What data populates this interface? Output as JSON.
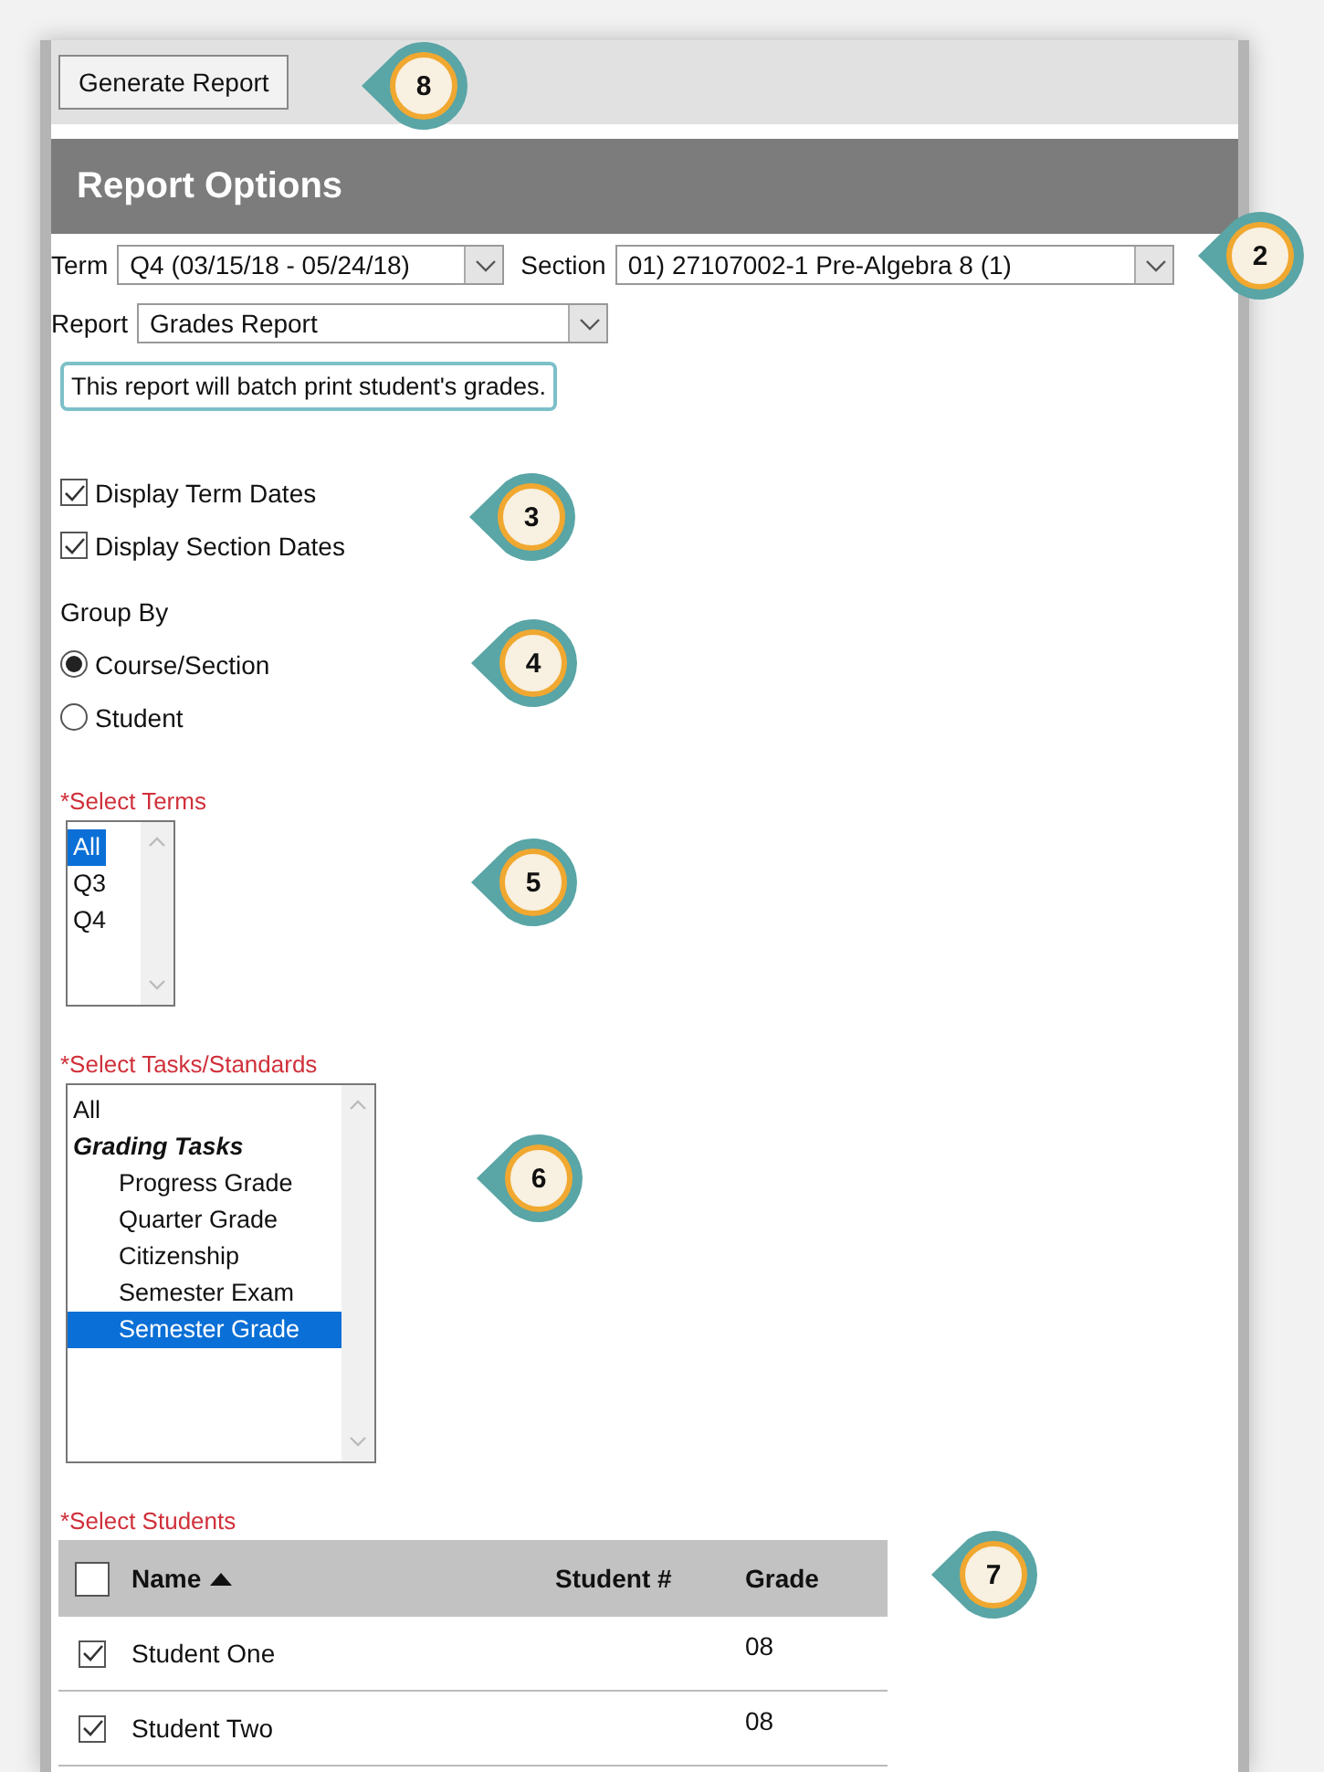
{
  "toolbar": {
    "buttons": [
      {
        "label": "Generate Report"
      }
    ]
  },
  "header": {
    "title": "Report Options"
  },
  "term": {
    "label": "Term",
    "value": "Q4 (03/15/18 - 05/24/18)"
  },
  "section": {
    "label": "Section",
    "value": "01) 27107002-1 Pre-Algebra 8 (1)"
  },
  "report": {
    "label": "Report",
    "value": "Grades Report"
  },
  "note": "This report will batch print student's grades.",
  "options": [
    {
      "label": "Display Term Dates",
      "checked": true
    },
    {
      "label": "Display Section Dates",
      "checked": true
    }
  ],
  "group_by": {
    "label": "Group By",
    "choices": [
      {
        "label": "Course/Section",
        "selected": true
      },
      {
        "label": "Student",
        "selected": false
      }
    ]
  },
  "select_terms": {
    "label": "*Select Terms",
    "items": [
      {
        "label": "All",
        "selected": true
      },
      {
        "label": "Q3",
        "selected": false
      },
      {
        "label": "Q4",
        "selected": false
      }
    ]
  },
  "select_tasks": {
    "label": "*Select Tasks/Standards",
    "items": [
      {
        "label": "All",
        "kind": "item",
        "selected": false
      },
      {
        "label": "Grading Tasks",
        "kind": "group",
        "selected": false,
        "children": [
          {
            "label": "Progress Grade",
            "selected": false
          },
          {
            "label": "Quarter Grade",
            "selected": false
          },
          {
            "label": "Citizenship",
            "selected": false
          },
          {
            "label": "Semester Exam",
            "selected": false
          },
          {
            "label": "Semester Grade",
            "selected": true
          }
        ]
      }
    ]
  },
  "select_students": {
    "label": "*Select Students",
    "all_checked": false,
    "columns": [
      "Name",
      "Student #",
      "Grade"
    ],
    "rows": [
      {
        "checked": true,
        "name": "Student One",
        "grade": "08"
      },
      {
        "checked": true,
        "name": "Student Two",
        "grade": "08"
      }
    ]
  },
  "callouts": [
    {
      "number": "8"
    },
    {
      "number": "2"
    },
    {
      "number": "3"
    },
    {
      "number": "4"
    },
    {
      "number": "5"
    },
    {
      "number": "6"
    },
    {
      "number": "7"
    }
  ]
}
